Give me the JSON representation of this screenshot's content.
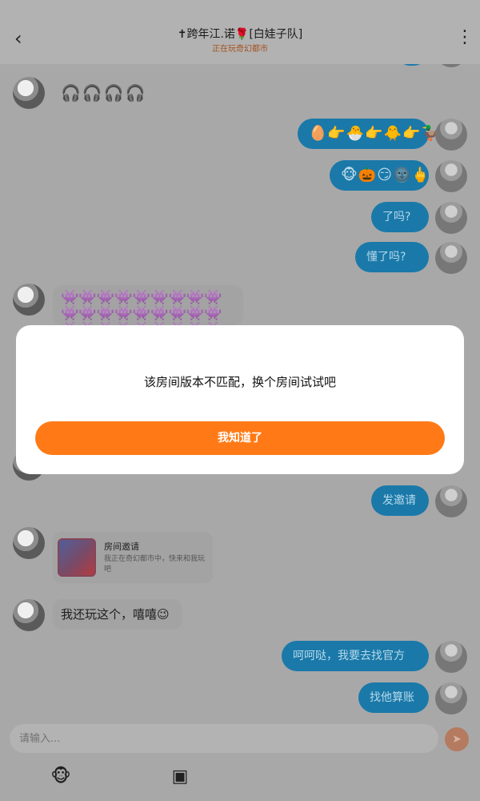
{
  "header": {
    "title": "✝跨年江.诺🌹[白娃子队]",
    "subtitle": "正在玩奇幻都市"
  },
  "messages": {
    "headphones": "🎧🎧🎧🎧",
    "emoji_row_1": "🥚👉🐣👉🐥👉🦆",
    "emoji_row_2": "🐵🎃😏🌚🖕",
    "understand_q": "了吗?",
    "understood_q": "懂了吗?",
    "invaders": "👾👾👾👾👾👾👾👾👾👾👾👾👾👾👾👾👾👾👾👾👾👾👾👾👾👾👾👾👾",
    "send_invite": "发邀请",
    "invite_card": {
      "title": "房间邀请",
      "desc": "我正在奇幻都市中，快来和我玩吧"
    },
    "still_playing": "我还玩这个，嘻嘻😉",
    "official": "呵呵哒，我要去找官方",
    "settle": "找他算账"
  },
  "input": {
    "placeholder": "请输入..."
  },
  "dialog": {
    "message": "该房间版本不匹配，换个房间试试吧",
    "button": "我知道了"
  }
}
